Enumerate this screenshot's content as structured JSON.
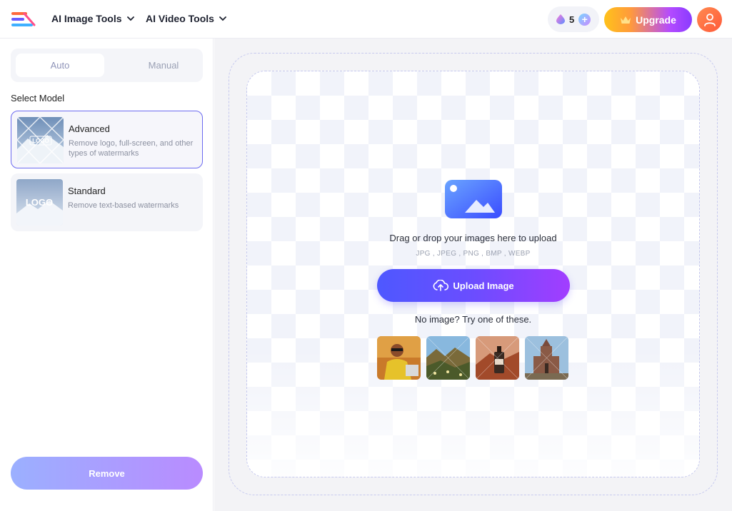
{
  "header": {
    "nav": [
      {
        "label": "AI Image Tools"
      },
      {
        "label": "AI Video Tools"
      }
    ],
    "credits": {
      "count": "5",
      "plus": "+"
    },
    "upgrade_label": "Upgrade"
  },
  "sidebar": {
    "modes": {
      "auto": "Auto",
      "manual": "Manual"
    },
    "section_title": "Select Model",
    "models": [
      {
        "name": "Advanced",
        "description": "Remove logo, full-screen, and other types of watermarks",
        "thumb_text": "LOGO"
      },
      {
        "name": "Standard",
        "description": "Remove text-based watermarks",
        "thumb_text": "LOGO"
      }
    ],
    "remove_label": "Remove"
  },
  "main": {
    "drop_text": "Drag or drop your images here to upload",
    "formats": "JPG , JPEG , PNG , BMP , WEBP",
    "upload_label": "Upload Image",
    "try_text": "No image? Try one of these."
  },
  "colors": {
    "accent": "#5b56f5",
    "upgrade_gradient_start": "#ffc21a",
    "upgrade_gradient_end": "#8a3bff"
  }
}
